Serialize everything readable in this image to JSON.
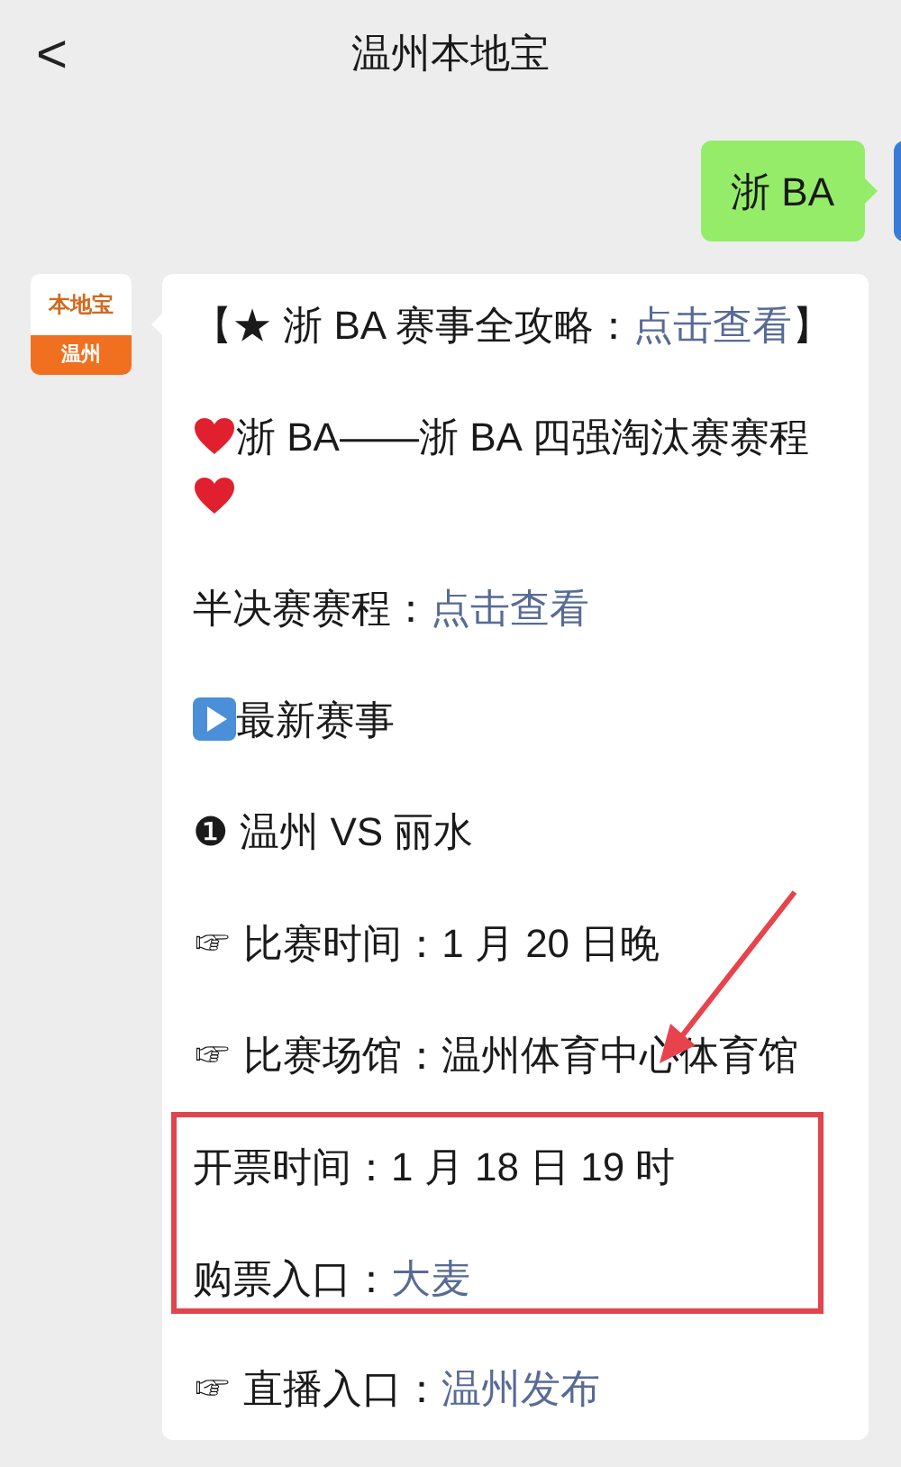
{
  "header": {
    "back": "<",
    "title": "温州本地宝"
  },
  "sent_message": {
    "text": "浙 BA"
  },
  "sender": {
    "logo_top": "本地宝",
    "logo_bottom": "温州"
  },
  "message": {
    "blocks": [
      {
        "kind": "line",
        "parts": [
          {
            "text": "【★ 浙 BA 赛事全攻略：",
            "link": false
          },
          {
            "text": "点击查看",
            "link": true
          },
          {
            "text": "】",
            "link": false
          }
        ]
      },
      {
        "kind": "heart_line",
        "parts": [
          {
            "text": "浙 BA——浙 BA 四强淘汰赛赛程",
            "link": false
          }
        ]
      },
      {
        "kind": "line",
        "parts": [
          {
            "text": "半决赛赛程：",
            "link": false
          },
          {
            "text": "点击查看",
            "link": true
          }
        ]
      },
      {
        "kind": "play_line",
        "parts": [
          {
            "text": "最新赛事",
            "link": false
          }
        ]
      },
      {
        "kind": "line",
        "parts": [
          {
            "text": "❶ 温州 VS 丽水",
            "link": false
          }
        ]
      },
      {
        "kind": "line",
        "parts": [
          {
            "text": "☞ 比赛时间：1 月 20 日晚",
            "link": false
          }
        ]
      },
      {
        "kind": "line",
        "parts": [
          {
            "text": "☞ 比赛场馆：温州体育中心体育馆",
            "link": false
          }
        ]
      },
      {
        "kind": "highlight",
        "lines": [
          {
            "kind": "line",
            "parts": [
              {
                "text": "开票时间：1 月 18 日 19 时",
                "link": false
              }
            ]
          },
          {
            "kind": "line",
            "parts": [
              {
                "text": "购票入口：",
                "link": false
              },
              {
                "text": "大麦",
                "link": true
              }
            ]
          }
        ]
      },
      {
        "kind": "line",
        "parts": [
          {
            "text": "☞ 直播入口：",
            "link": false
          },
          {
            "text": "温州发布",
            "link": true
          }
        ]
      }
    ]
  }
}
